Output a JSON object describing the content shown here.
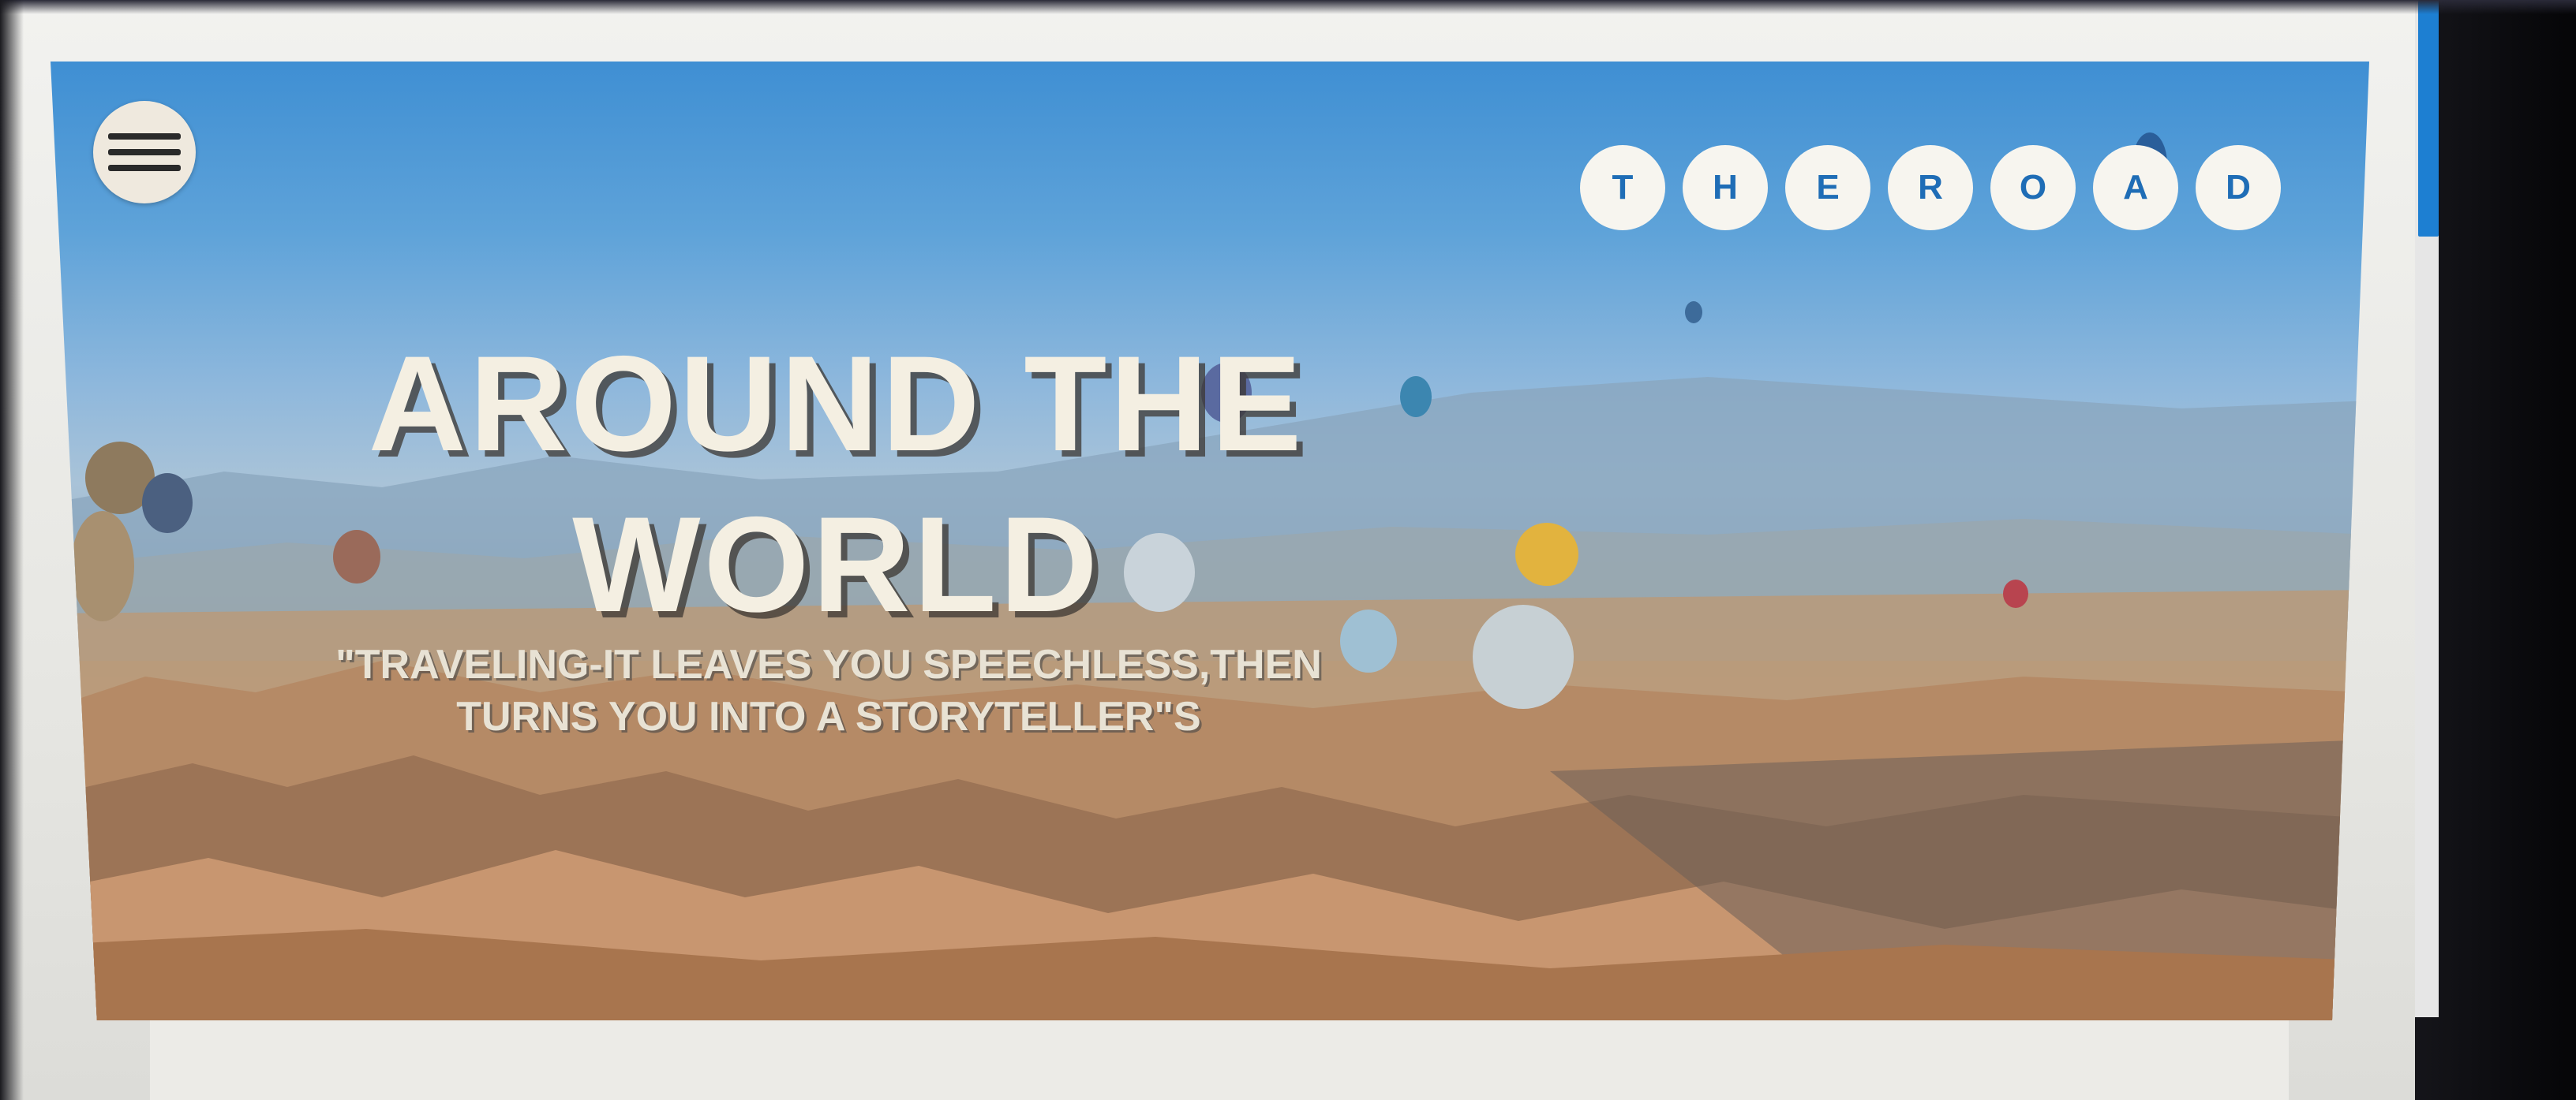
{
  "header": {
    "menu_icon": "hamburger-menu-icon",
    "logo_letters": [
      "T",
      "H",
      "E",
      "R",
      "O",
      "A",
      "D"
    ]
  },
  "hero": {
    "headline": "AROUND THE WORLD",
    "quote": "\"TRAVELING-IT LEAVES YOU SPEECHLESS,THEN TURNS YOU INTO A STORYTELLER\"S"
  },
  "colors": {
    "logo_text": "#1f6db6",
    "logo_bg": "#f7f5ef",
    "headline": "#f4efe2",
    "scroll_thumb": "#1d7fd2"
  }
}
